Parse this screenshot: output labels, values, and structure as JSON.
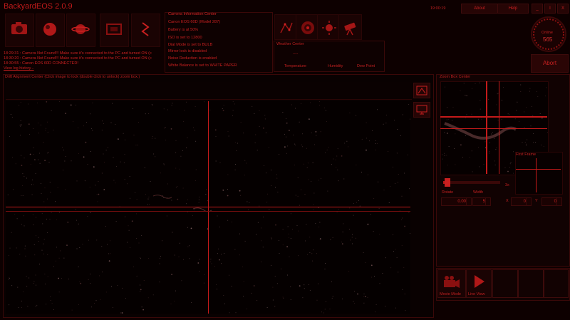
{
  "app": {
    "title": "BackyardEOS 2.0.9",
    "time": "19:00:19"
  },
  "header_buttons": {
    "about": "About",
    "help": "Help",
    "minimize": "_",
    "restore": "I",
    "close": "X"
  },
  "toolbar": [
    {
      "name": "camera-tool",
      "icon": "camera-icon"
    },
    {
      "name": "focus-tool",
      "icon": "planet-icon"
    },
    {
      "name": "planetary-tool",
      "icon": "saturn-icon"
    },
    {
      "name": "imaging-tool",
      "icon": "frame-icon"
    },
    {
      "name": "settings-tool",
      "icon": "lightning-icon"
    }
  ],
  "log": {
    "lines": [
      "18:29:31 : Camera Not Found!!! Make sure it's connected to the PC and turned ON (c",
      "18:30:20 : Camera Not Found!!! Make sure it's connected to the PC and turned ON (c",
      "18:30:55 : Canon EOS 60D CONNECTED!"
    ],
    "link": "View log history..."
  },
  "camera_info": {
    "title": "Camera Information Center",
    "lines": [
      "Canon EOS 60D  (Model 287)",
      "Battery is at 50%",
      "ISO is set to 12800",
      "Dial Mode is set to BULB",
      "Mirror lock is disabled",
      "Noise Reduction is enabled",
      "White Balance is set to WHITE PAPER"
    ]
  },
  "weather": {
    "title": "Weather Center",
    "value": "----",
    "labels": [
      "Temperature",
      "Humidity",
      "Dew Point"
    ]
  },
  "status": {
    "state": "Online",
    "count": "565",
    "abort": "Abort"
  },
  "drift": {
    "title": "Drift Alignment Center    (Click image to lock (double click to unlock) zoom box.)"
  },
  "zoom": {
    "title": "Zoom Box Center",
    "first_frame": "First Frame",
    "zoom_level": "3x",
    "rotate_label": "Rotate",
    "width_label": "Width",
    "rotate_value": "0.00",
    "width_value": "5",
    "x_label": "X",
    "y_label": "Y",
    "x_value": "0",
    "y_value": "0",
    "slider_level": 0.08
  },
  "bottom_buttons": [
    {
      "name": "movie-button",
      "icon": "movie-camera-icon",
      "label": "Movie Mode"
    },
    {
      "name": "play-button",
      "icon": "play-icon",
      "label": "Live View"
    }
  ]
}
